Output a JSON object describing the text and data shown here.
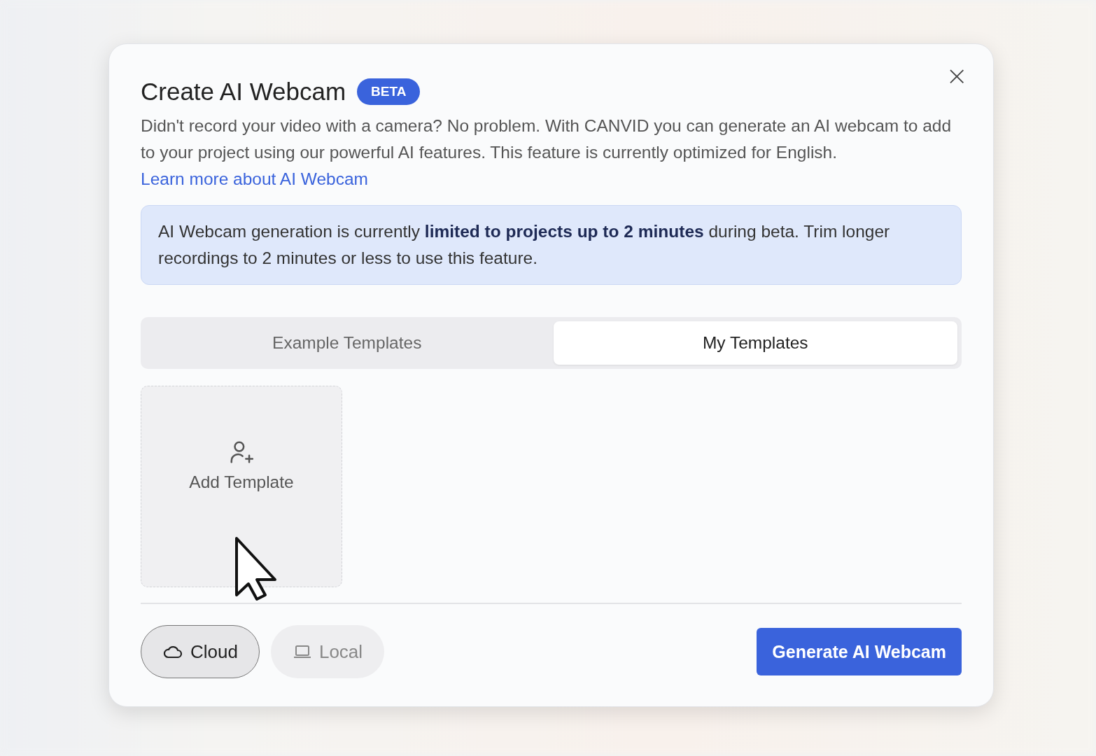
{
  "dialog": {
    "title": "Create AI Webcam",
    "badge": "BETA",
    "close": "×",
    "description": "Didn't record your video with a camera? No problem. With CANVID you can generate an AI webcam to add to your project using our powerful AI features. This feature is currently optimized for English.",
    "link": "Learn more about AI Webcam",
    "notice": "AI Webcam generation is currently **limited to projects up to 2 minutes** during beta. Trim longer recordings to 2 minutes or less to use this feature.",
    "tabs": [
      {
        "label": "Example Templates",
        "selected": false
      },
      {
        "label": "My Templates",
        "selected": true
      }
    ],
    "add_template": "Add Template",
    "modes": [
      {
        "label": "Cloud",
        "kind": "cloud",
        "selected": true
      },
      {
        "label": "Local",
        "kind": "laptop",
        "selected": false
      }
    ],
    "primary_button": "Generate AI Webcam"
  }
}
